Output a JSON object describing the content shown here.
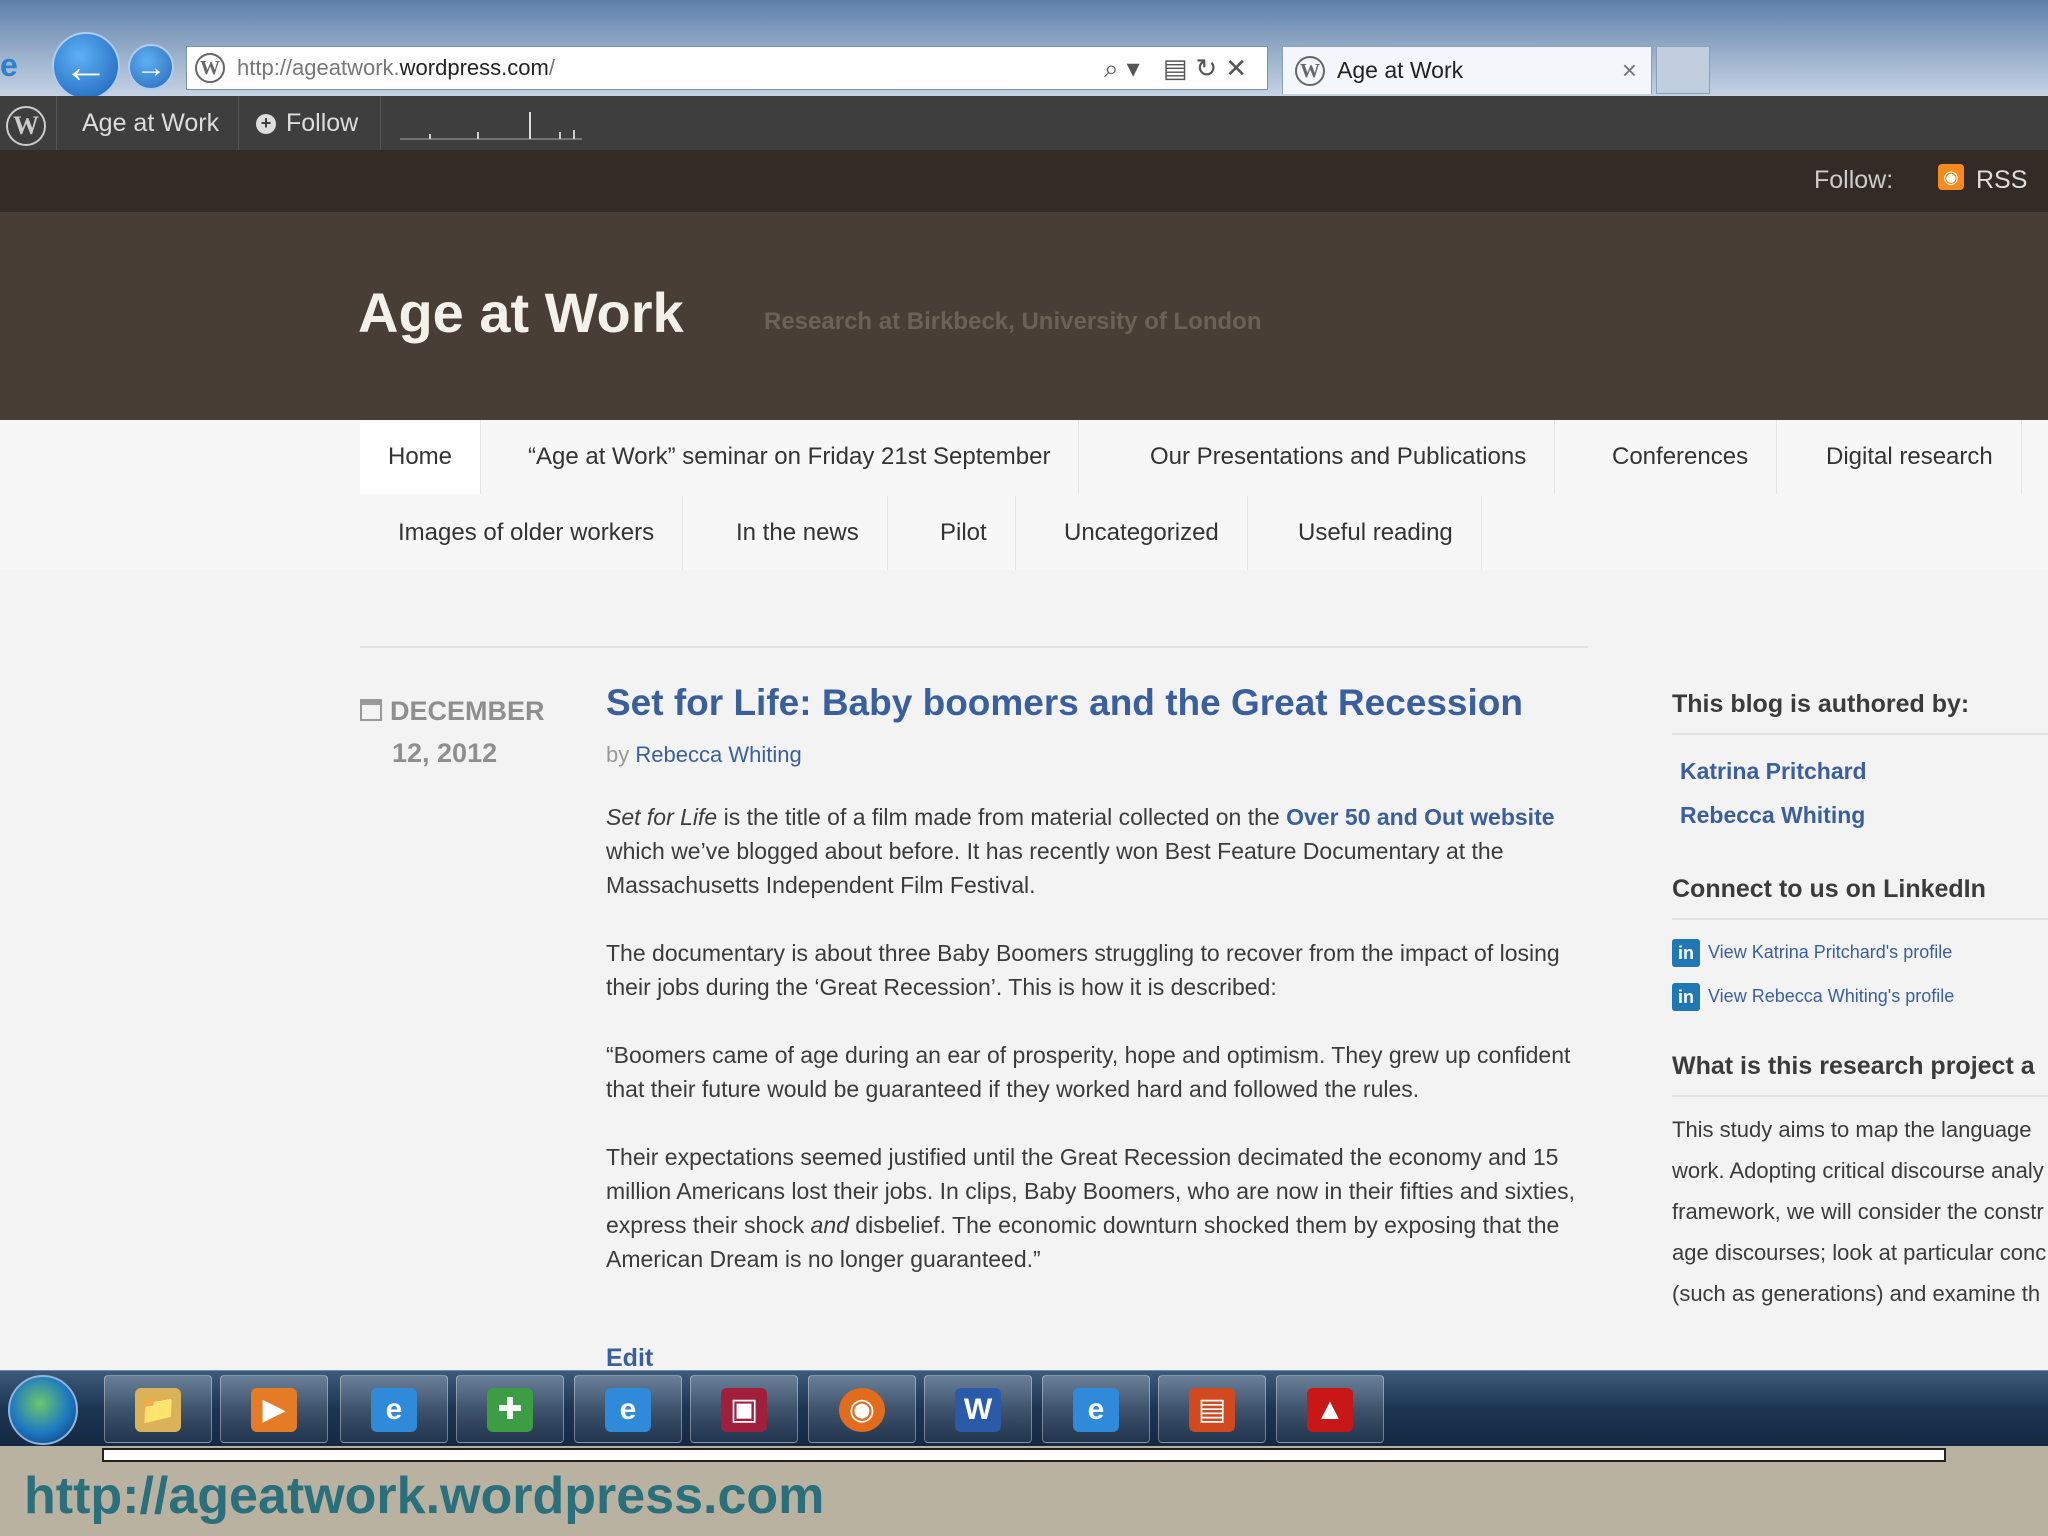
{
  "browser": {
    "url_prefix": "http://ageatwork.",
    "url_host": "wordpress.com",
    "url_suffix": "/",
    "tab_title": "Age at Work",
    "tab_close": "×",
    "address_tools": "⌕▾ ▤↻✕",
    "back": "←",
    "forward": "→",
    "ie_icon": "e",
    "wp_icon": "W"
  },
  "adminbar": {
    "site": "Age at Work",
    "follow": "Follow",
    "follow_icon": "+",
    "wp_icon": "W"
  },
  "followbar": {
    "label": "Follow:",
    "rss": "RSS",
    "rss_icon": "◉"
  },
  "header": {
    "title": "Age at Work",
    "tagline": "Research at Birkbeck, University of London"
  },
  "nav": {
    "items": [
      "Home",
      "“Age at Work” seminar on Friday 21st September",
      "Our Presentations and Publications",
      "Conferences",
      "Digital research",
      "Images of older workers",
      "In the news",
      "Pilot",
      "Uncategorized",
      "Useful reading"
    ]
  },
  "post": {
    "date_month": "DECEMBER",
    "date_day": "12, 2012",
    "title": "Set for Life: Baby boomers and the Great Recession",
    "by": "by",
    "author": "Rebecca Whiting",
    "p1_italic": "Set for Life",
    "p1_a": " is the title of a film made from material collected on the ",
    "p1_link": "Over 50 and Out website",
    "p1_b": " which we’ve blogged about before. It has recently won Best Feature Documentary at the Massachusetts Independent Film Festival.",
    "p2": "The documentary is about three Baby Boomers struggling to recover from the impact of losing their jobs during the ‘Great Recession’. This is how it is described:",
    "p3": "“Boomers came of age during an ear of prosperity, hope and optimism.  They grew up confident that their future would be guaranteed if they worked hard and followed the rules.",
    "p4_a": "Their expectations seemed justified until the Great Recession decimated the economy and 15 million Americans lost their jobs. In clips, Baby Boomers, who are now in their fifties and sixties, express their shock ",
    "p4_italic": "and",
    "p4_b": " disbelief. The economic downturn shocked them by exposing that the American Dream is no longer guaranteed.”",
    "edit": "Edit"
  },
  "sidebar": {
    "authored_title": "This blog is authored by:",
    "authors": [
      "Katrina Pritchard",
      "Rebecca Whiting"
    ],
    "linkedin_title": "Connect to us on LinkedIn",
    "linkedin_icon": "in",
    "linkedin_links": [
      "View Katrina Pritchard's profile",
      "View Rebecca Whiting's profile"
    ],
    "research_title": "What is this research project a",
    "research_lines": [
      "This study aims to map the language ",
      "work. Adopting critical discourse analy",
      "framework, we will consider the constr",
      "age discourses; look at particular conc",
      "(such as generations) and examine th"
    ]
  },
  "taskbar": {
    "icons": [
      "📁",
      "▶",
      "e",
      "✚",
      "e",
      "▣",
      "◉",
      "W",
      "e",
      "▤",
      "▲"
    ]
  },
  "slide_url": "http://ageatwork.wordpress.com"
}
